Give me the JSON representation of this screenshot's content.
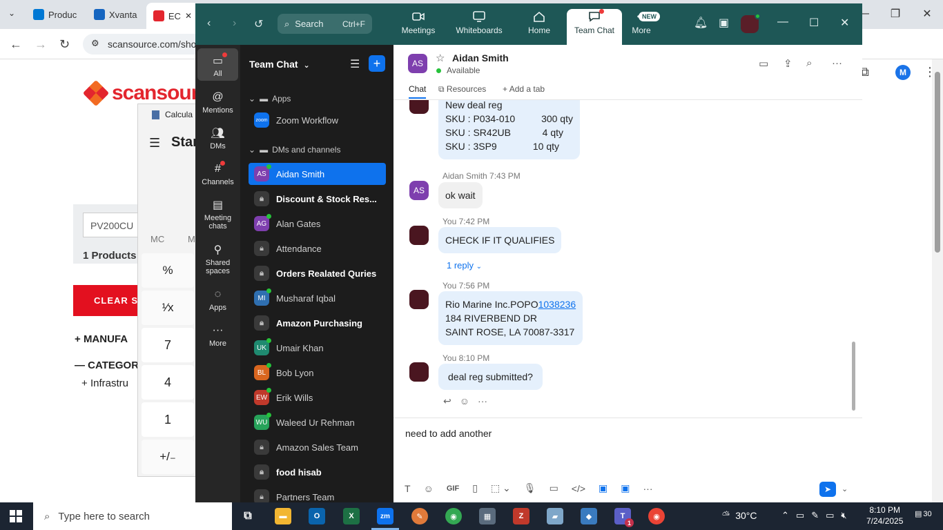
{
  "browser": {
    "tabs": [
      {
        "label": "Produc",
        "icon_color": "#0078d4"
      },
      {
        "label": "Xvanta",
        "icon_color": "#1565c0"
      },
      {
        "label": "EC",
        "icon_color": "#e3262e"
      }
    ],
    "url": "scansource.com/sho",
    "profile_initial": "M"
  },
  "page": {
    "logo_text": "scansourc",
    "search_value": "PV200CU",
    "product_count": "1 Products",
    "clear_label": "CLEAR S",
    "facets": [
      "MANUFA",
      "CATEGOR"
    ],
    "subfacet": "Infrastru"
  },
  "calculator": {
    "title": "Calcula",
    "mode": "Stan",
    "mem": "MC",
    "mem2": "M",
    "keys": [
      "%",
      "¹⁄x",
      "7",
      "4",
      "1",
      "+/₋"
    ]
  },
  "zoom": {
    "search_label": "Search",
    "search_shortcut": "Ctrl+F",
    "nav": [
      {
        "label": "Meetings"
      },
      {
        "label": "Whiteboards"
      },
      {
        "label": "Home"
      },
      {
        "label": "Team Chat"
      },
      {
        "label": "More"
      }
    ],
    "new_badge": "NEW",
    "rail": [
      {
        "label": "All"
      },
      {
        "label": "Mentions"
      },
      {
        "label": "DMs"
      },
      {
        "label": "Channels"
      },
      {
        "label": "Meeting chats"
      },
      {
        "label": "Shared spaces"
      },
      {
        "label": "Apps"
      },
      {
        "label": "More"
      }
    ],
    "list_title": "Team Chat",
    "sections": {
      "apps": "Apps",
      "dms": "DMs and channels"
    },
    "apps": [
      {
        "label": "Zoom Workflow",
        "badge": "zoom"
      }
    ],
    "channels": [
      {
        "label": "Aidan Smith",
        "initials": "AS",
        "color": "#7e3fae",
        "type": "dm",
        "selected": true
      },
      {
        "label": "Discount & Stock Res...",
        "type": "lock",
        "bold": true
      },
      {
        "label": "Alan Gates",
        "initials": "AG",
        "color": "#7e3fae",
        "type": "dm"
      },
      {
        "label": "Attendance",
        "type": "lock"
      },
      {
        "label": "Orders Realated Quries",
        "type": "lock",
        "bold": true
      },
      {
        "label": "Musharaf Iqbal",
        "initials": "MI",
        "color": "#2f6fb0",
        "type": "dm"
      },
      {
        "label": "Amazon Purchasing",
        "type": "lock",
        "bold": true
      },
      {
        "label": "Umair Khan",
        "initials": "UK",
        "color": "#1f8a70",
        "type": "dm"
      },
      {
        "label": "Bob Lyon",
        "initials": "BL",
        "color": "#d9661f",
        "type": "dm"
      },
      {
        "label": "Erik Wills",
        "initials": "EW",
        "color": "#c0392b",
        "type": "dm"
      },
      {
        "label": "Waleed Ur Rehman",
        "initials": "WU",
        "color": "#27a35a",
        "type": "dm"
      },
      {
        "label": "Amazon Sales Team",
        "type": "lock"
      },
      {
        "label": "food hisab",
        "type": "lock",
        "bold": true
      },
      {
        "label": "Partners Team",
        "type": "lock"
      }
    ],
    "peer": {
      "initials": "AS",
      "name": "Aidan Smith",
      "status": "Available"
    },
    "chat_tabs": [
      "Chat",
      "Resources",
      "Add a tab"
    ],
    "messages": {
      "m1": {
        "title": "New deal reg",
        "lines": [
          {
            "sku": "SKU : P034-010",
            "qty": "300 qty"
          },
          {
            "sku": "SKU : SR42UB",
            "qty": "4 qty"
          },
          {
            "sku": "SKU : 3SP9",
            "qty": "10 qty"
          }
        ]
      },
      "m2": {
        "sender": "Aidan Smith",
        "time": "7:43 PM",
        "initials": "AS",
        "text": "ok wait"
      },
      "m3": {
        "sender": "You",
        "time": "7:42 PM",
        "text": "CHECK IF IT QUALIFIES",
        "reply": "1 reply"
      },
      "m4": {
        "sender": "You",
        "time": "7:56 PM",
        "line1_prefix": "Rio Marine Inc.POPO",
        "line1_link": "1038236",
        "line2": "184 RIVERBEND DR",
        "line3": "SAINT ROSE, LA 70087-3317"
      },
      "m5": {
        "sender": "You",
        "time": "8:10 PM",
        "text": "deal reg submitted?"
      }
    },
    "composer_text": "need to add another",
    "composer_gif": "GIF"
  },
  "taskbar": {
    "search_placeholder": "Type here to search",
    "temperature": "30°C",
    "time": "8:10 PM",
    "date": "7/24/2025",
    "notif_count": "30",
    "teams_badge": "1"
  }
}
